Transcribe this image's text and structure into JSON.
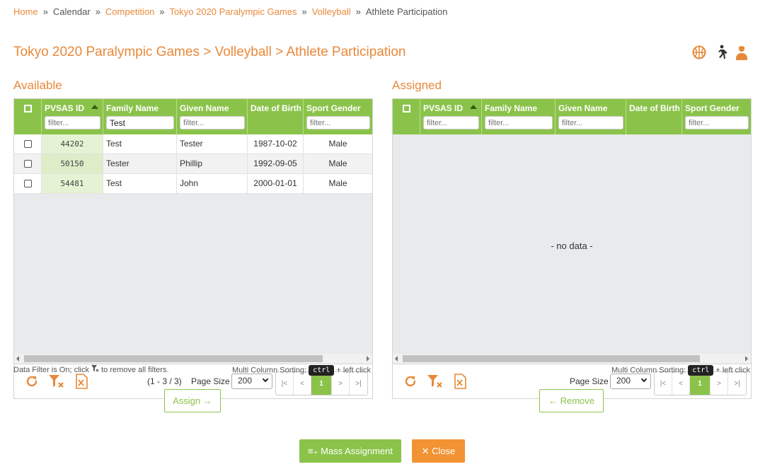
{
  "breadcrumb": {
    "home": "Home",
    "calendar": "Calendar",
    "competition": "Competition",
    "games": "Tokyo 2020 Paralympic Games",
    "sport": "Volleyball",
    "current": "Athlete Participation",
    "separator": "»"
  },
  "page_title": "Tokyo 2020 Paralympic Games > Volleyball > Athlete Participation",
  "title_icons": [
    "basketball-icon",
    "runner-icon",
    "person-icon"
  ],
  "colors": {
    "accent": "#e8893a",
    "grid_header": "#8bc34a",
    "close_button": "#f29333"
  },
  "columns": {
    "pvsas_id": "PVSAS ID",
    "family_name": "Family Name",
    "given_name": "Given Name",
    "dob": "Date of Birth",
    "sport_gender": "Sport Gender"
  },
  "filter_placeholder": "filter...",
  "available": {
    "title": "Available",
    "family_filter_value": "Test",
    "rows": [
      {
        "id": "44202",
        "family": "Test",
        "given": "Tester",
        "dob": "1987-10-02",
        "gender": "Male"
      },
      {
        "id": "50150",
        "family": "Tester",
        "given": "Phillip",
        "dob": "1992-09-05",
        "gender": "Male"
      },
      {
        "id": "54481",
        "family": "Test",
        "given": "John",
        "dob": "2000-01-01",
        "gender": "Male"
      }
    ],
    "range": "(1 - 3 / 3)",
    "page_size_label": "Page Size",
    "page_size": "200",
    "current_page": "1",
    "filter_note_before": "Data Filter is On; click",
    "filter_note_after": "to remove all filters.",
    "sort_note": "Multi Column Sorting:",
    "sort_key": "ctrl",
    "sort_click": "+ left click"
  },
  "assigned": {
    "title": "Assigned",
    "no_data": "- no data -",
    "page_size_label": "Page Size",
    "page_size": "200",
    "current_page": "1",
    "sort_note": "Multi Column Sorting:",
    "sort_key": "ctrl",
    "sort_click": "+ left click"
  },
  "pager_symbols": {
    "first": "|<",
    "prev": "<",
    "next": ">",
    "last": ">|"
  },
  "buttons": {
    "assign": "Assign →",
    "remove": "← Remove",
    "mass_assignment": "≡₊ Mass Assignment",
    "close": "✕ Close"
  }
}
